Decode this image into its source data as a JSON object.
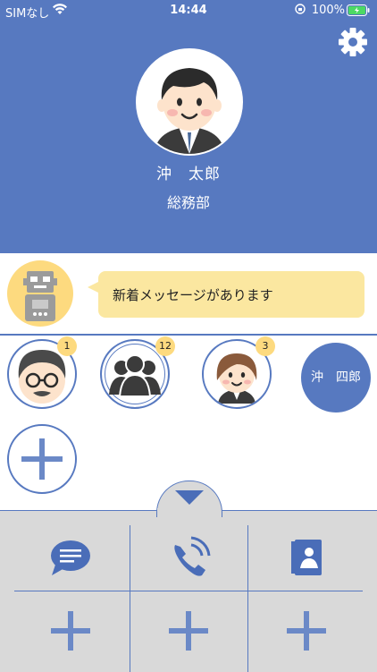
{
  "status": {
    "carrier": "SIMなし",
    "time": "14:44",
    "battery": "100%"
  },
  "profile": {
    "name": "沖　太郎",
    "department": "総務部"
  },
  "message": {
    "text": "新着メッセージがあります"
  },
  "contacts": [
    {
      "name": "man-glasses",
      "badge": "1"
    },
    {
      "name": "group",
      "badge": "12"
    },
    {
      "name": "woman",
      "badge": "3"
    }
  ],
  "named_contact": {
    "label": "沖　四郎"
  },
  "icons": {
    "settings": "gear-icon",
    "chat": "chat-icon",
    "call": "phone-icon",
    "addressbook": "contacts-book-icon",
    "add": "plus-icon",
    "toggle": "triangle-down-icon"
  },
  "colors": {
    "primary": "#5779c0",
    "accent": "#fdda7f",
    "bubble": "#fbe7a0",
    "drawer": "#d9d9d9"
  }
}
